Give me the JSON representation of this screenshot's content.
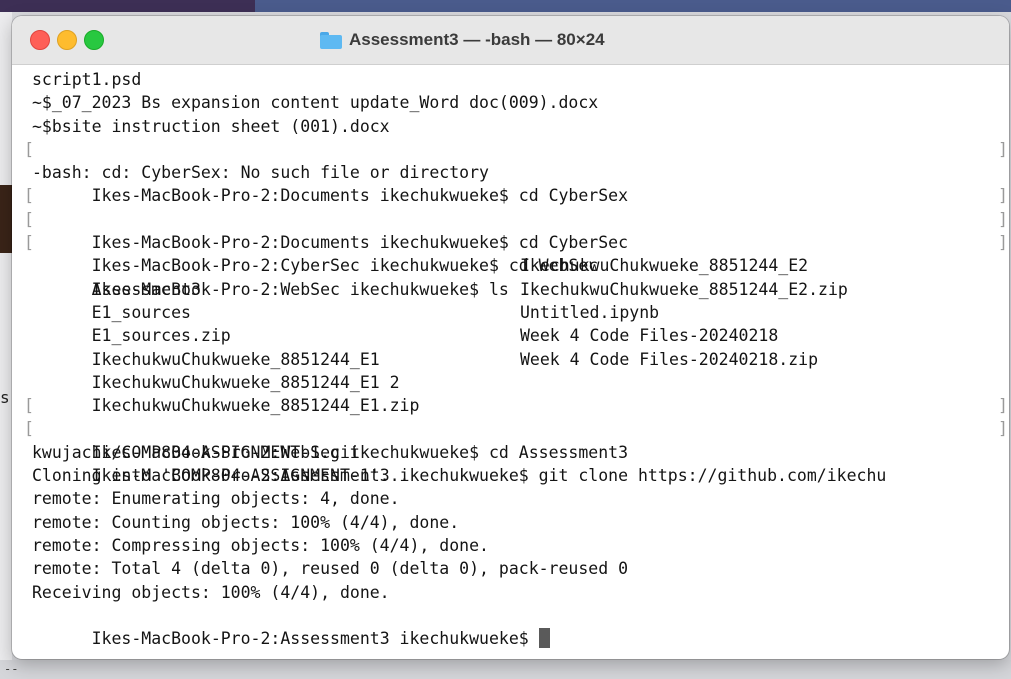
{
  "window": {
    "title": "Assessment3 — -bash — 80×24"
  },
  "desktop": {
    "glyph": "s",
    "dash": "--"
  },
  "terminal": {
    "lines": {
      "l01": "script1.psd",
      "l02": "~$_07_2023 Bs expansion content update_Word doc(009).docx",
      "l03": "~$bsite instruction sheet (001).docx",
      "l04": "Ikes-MacBook-Pro-2:Documents ikechukwueke$ cd CyberSex",
      "l05": "-bash: cd: CyberSex: No such file or directory",
      "l06": "Ikes-MacBook-Pro-2:Documents ikechukwueke$ cd CyberSec",
      "l07": "Ikes-MacBook-Pro-2:CyberSec ikechukwueke$ cd WebSec",
      "l08": "Ikes-MacBook-Pro-2:WebSec ikechukwueke$ ls",
      "l15": "Ikes-MacBook-Pro-2:WebSec ikechukwueke$ cd Assessment3",
      "l16": "Ikes-MacBook-Pro-2:Assessment3 ikechukwueke$ git clone https://github.com/ikechu",
      "l17": "kwujachi/COMP804-ASSIGNMENT-1.git",
      "l18": "Cloning into 'COMP804-ASSIGNMENT-1'...",
      "l19": "remote: Enumerating objects: 4, done.",
      "l20": "remote: Counting objects: 100% (4/4), done.",
      "l21": "remote: Compressing objects: 100% (4/4), done.",
      "l22": "remote: Total 4 (delta 0), reused 0 (delta 0), pack-reused 0",
      "l23": "Receiving objects: 100% (4/4), done.",
      "l24": "Ikes-MacBook-Pro-2:Assessment3 ikechukwueke$ "
    },
    "ls_left": [
      "Assessment3",
      "E1_sources",
      "E1_sources.zip",
      "IkechukwuChukwueke_8851244_E1",
      "IkechukwuChukwueke_8851244_E1 2",
      "IkechukwuChukwueke_8851244_E1.zip"
    ],
    "ls_right": [
      "IkechukwuChukwueke_8851244_E2",
      "IkechukwuChukwueke_8851244_E2.zip",
      "Untitled.ipynb",
      "Week 4 Code Files-20240218",
      "Week 4 Code Files-20240218.zip"
    ],
    "bracket_open": "[",
    "bracket_close": "]"
  },
  "colors": {
    "close": "#fe5f57",
    "minimize": "#febc2e",
    "zoom": "#28c840",
    "folder": "#5eb9f2"
  }
}
